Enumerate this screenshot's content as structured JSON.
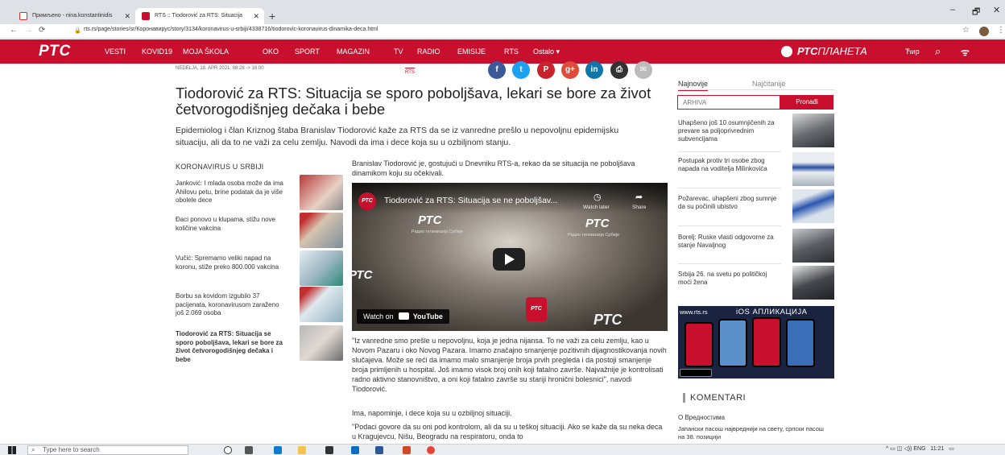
{
  "browser": {
    "tabs": [
      {
        "label": "Примљено - nina.konstantinidis",
        "close": "✕"
      },
      {
        "label": "RTS :: Tiodorović za RTS: Situacija",
        "close": "✕"
      }
    ],
    "new_tab": "+",
    "window_controls": [
      "–",
      "🗗",
      "✕"
    ],
    "url": "rts.rs/page/stories/sr/Коронавирус/story/3134/koronavirus-u-srbiji/4338716/tiodorovic-koronavirus-dinamika-deca.html"
  },
  "site": {
    "logo": "РТС",
    "nav": [
      "VESTI",
      "KOVID19",
      "MOJA ŠKOLA",
      "OKO",
      "SPORT",
      "MAGAZIN",
      "TV",
      "RADIO",
      "EMISIJE",
      "RTS",
      "Ostalo ▾"
    ],
    "planeta_brand": "РТС",
    "planeta_suffix": "ПЛАНЕТА",
    "script_toggle": "Ћир",
    "colors": {
      "brand": "#c8102e"
    }
  },
  "article": {
    "dateline": "NEDELJA, 18. APR 2021, 08:28 -> 16:00",
    "tag": "RTS",
    "social": [
      {
        "icon": "facebook-icon",
        "glyph": "f",
        "color": "#3b5998"
      },
      {
        "icon": "twitter-icon",
        "glyph": "t",
        "color": "#1da1f2"
      },
      {
        "icon": "pinterest-icon",
        "glyph": "P",
        "color": "#c8232c"
      },
      {
        "icon": "google-plus-icon",
        "glyph": "g+",
        "color": "#dd4b39"
      },
      {
        "icon": "linkedin-icon",
        "glyph": "in",
        "color": "#0e76a8"
      },
      {
        "icon": "print-icon",
        "glyph": "⎙",
        "color": "#333333"
      },
      {
        "icon": "email-icon",
        "glyph": "✉",
        "color": "#bbbbbb"
      }
    ],
    "title": "Tiodorović za RTS: Situacija se sporo poboljšava, lekari se bore za život četvorogodišnjeg dečaka i bebe",
    "lead": "Epidemiolog i član Kriznog štaba Branislav Tiodorović kaže za RTS da se iz vanredne prešlo u nepovoljnu epidemijsku situaciju, ali da to ne važi za celu zemlju. Navodi da ima i dece koja su u ozbiljnom stanju.",
    "intro": "Branislav Tiodorović je, gostujući u Dnevniku RTS-a, rekao da se situacija ne poboljšava dinamikom koju su očekivali.",
    "video": {
      "title": "Tiodorović za RTS: Situacija se ne poboljšav...",
      "watch_later": "Watch later",
      "share": "Share",
      "watch_on": "Watch on",
      "youtube": "YouTube",
      "logo_text": "РТС",
      "channel_text": "Радио телевизија Србије"
    },
    "paragraphs": [
      "\"Iz vanredne smo prešle u nepovoljnu, koja je jedna nijansa. To ne važi za celu zemlju, kao u Novom Pazaru i oko Novog Pazara. Imamo značajno smanjenje pozitivnih dijagnostikovanja novih slučajeva. Može se reći da imamo malo smanjenje broja prvih pregleda i da postoji smanjenje broja primljenih u hospital. Još imamo visok broj onih koji fatalno završe. Najvažnije je kontrolisati radno aktivno stanovništvo, a oni koji fatalno završe su stariji hronični bolesnici\", navodi Tiodorović.",
      "Ima, napominje, i dece koja su u ozbiljnoj situaciji.",
      "\"Podaci govore da su oni pod kontrolom, ali da su u teškoj situaciji. Ako se kaže da su neka deca u Kragujevcu, Nišu, Beogradu na respiratoru, onda to"
    ]
  },
  "related": {
    "heading": "KORONAVIRUS U SRBIJI",
    "items": [
      {
        "text": "Janković: I mlada osoba može da ima Ahilovu petu, brine podatak da je više obolele dece"
      },
      {
        "text": "Đaci ponovo u klupama, stižu nove količine vakcina"
      },
      {
        "text": "Vučić: Spremamo veliki napad na koronu, stiže preko 800.000 vakcina"
      },
      {
        "text": "Borbu sa kovidom izgubilo 37 pacijenata, koronavirusom zaraženo još 2.069 osoba"
      },
      {
        "text": "Tiodorović za RTS: Situacija se sporo poboljšava, lekari se bore za život četvorogodišnjeg dečaka i bebe"
      }
    ]
  },
  "sidebar": {
    "tabs": [
      "Najnovije",
      "Najčitanije"
    ],
    "archive_placeholder": "ARHIVA",
    "search_button": "Pronađi",
    "news": [
      "Uhapšeno još 10 osumnjičenih za prevare sa poljoprivrednim subvencijama",
      "Postupak protiv tri osobe zbog napada na voditelja Milinkovića",
      "Požarevac, uhapšeni zbog sumnje da su počinili ubistvo",
      "Borelj: Ruske vlasti odgovorne za stanje Navaljnog",
      "Srbija 26. na svetu po političkoj moći žena"
    ],
    "promo": {
      "site": "www.rts.rs",
      "label": "iOS АПЛИКАЦИЈА"
    },
    "comments_heading": "KOMENTARI",
    "comments_title": "О Вредностима",
    "comments_item": "Јапански пасош највреднији на свету, српски пасош на 38. позицији"
  },
  "taskbar": {
    "search_placeholder": "Type here to search",
    "time": "11:21",
    "lang": "ENG"
  }
}
